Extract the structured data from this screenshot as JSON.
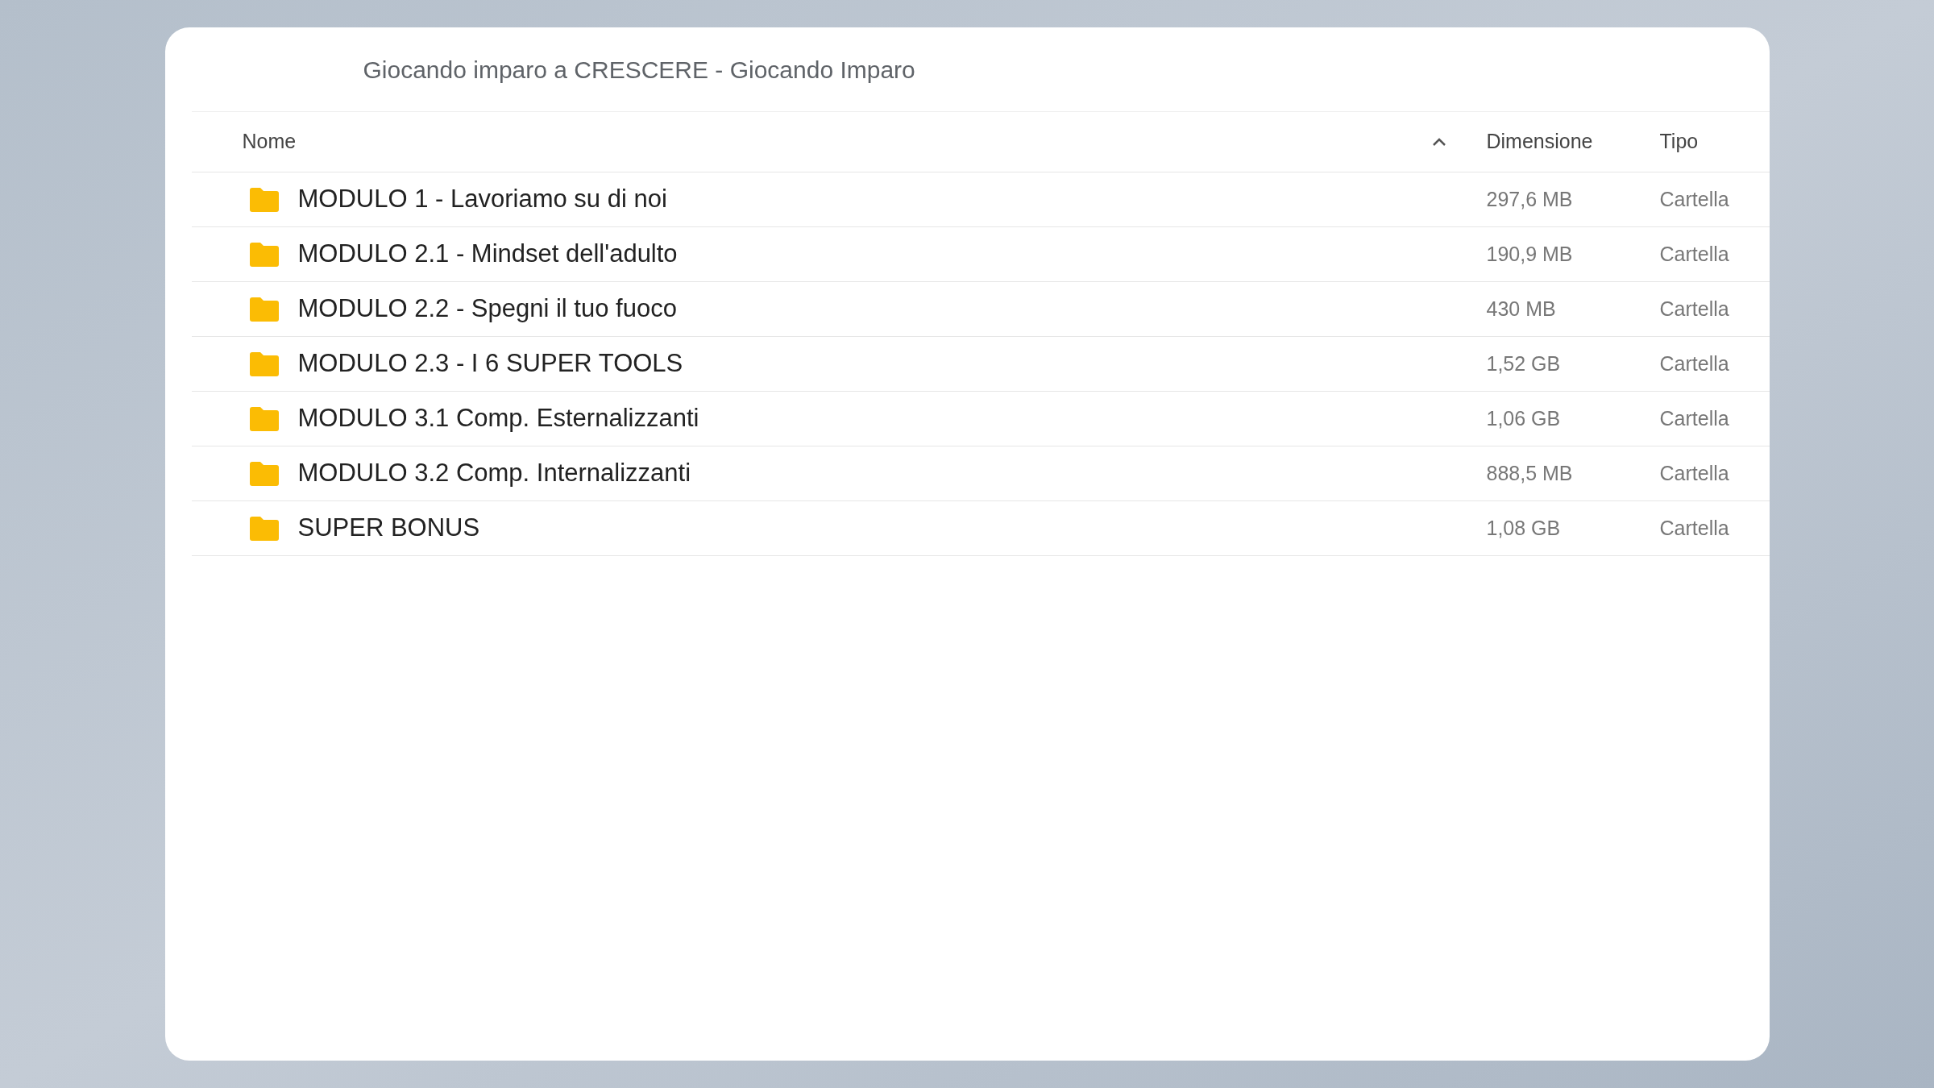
{
  "window": {
    "title": "Giocando imparo a CRESCERE - Giocando Imparo"
  },
  "table": {
    "columns": [
      {
        "label": "Nome",
        "sorted": true
      },
      {
        "label": "Dimensione",
        "sorted": false
      },
      {
        "label": "Tipo",
        "sorted": false
      }
    ],
    "rows": [
      {
        "name": "MODULO 1 - Lavoriamo su di noi",
        "size": "297,6 MB",
        "type": "Cartella"
      },
      {
        "name": "MODULO 2.1 - Mindset dell'adulto",
        "size": "190,9 MB",
        "type": "Cartella"
      },
      {
        "name": "MODULO 2.2 - Spegni il tuo fuoco",
        "size": "430 MB",
        "type": "Cartella"
      },
      {
        "name": "MODULO 2.3 - I 6 SUPER TOOLS",
        "size": "1,52 GB",
        "type": "Cartella"
      },
      {
        "name": "MODULO 3.1 Comp. Esternalizzanti",
        "size": "1,06 GB",
        "type": "Cartella"
      },
      {
        "name": "MODULO 3.2 Comp. Internalizzanti",
        "size": "888,5 MB",
        "type": "Cartella"
      },
      {
        "name": "SUPER BONUS",
        "size": "1,08 GB",
        "type": "Cartella"
      }
    ]
  }
}
